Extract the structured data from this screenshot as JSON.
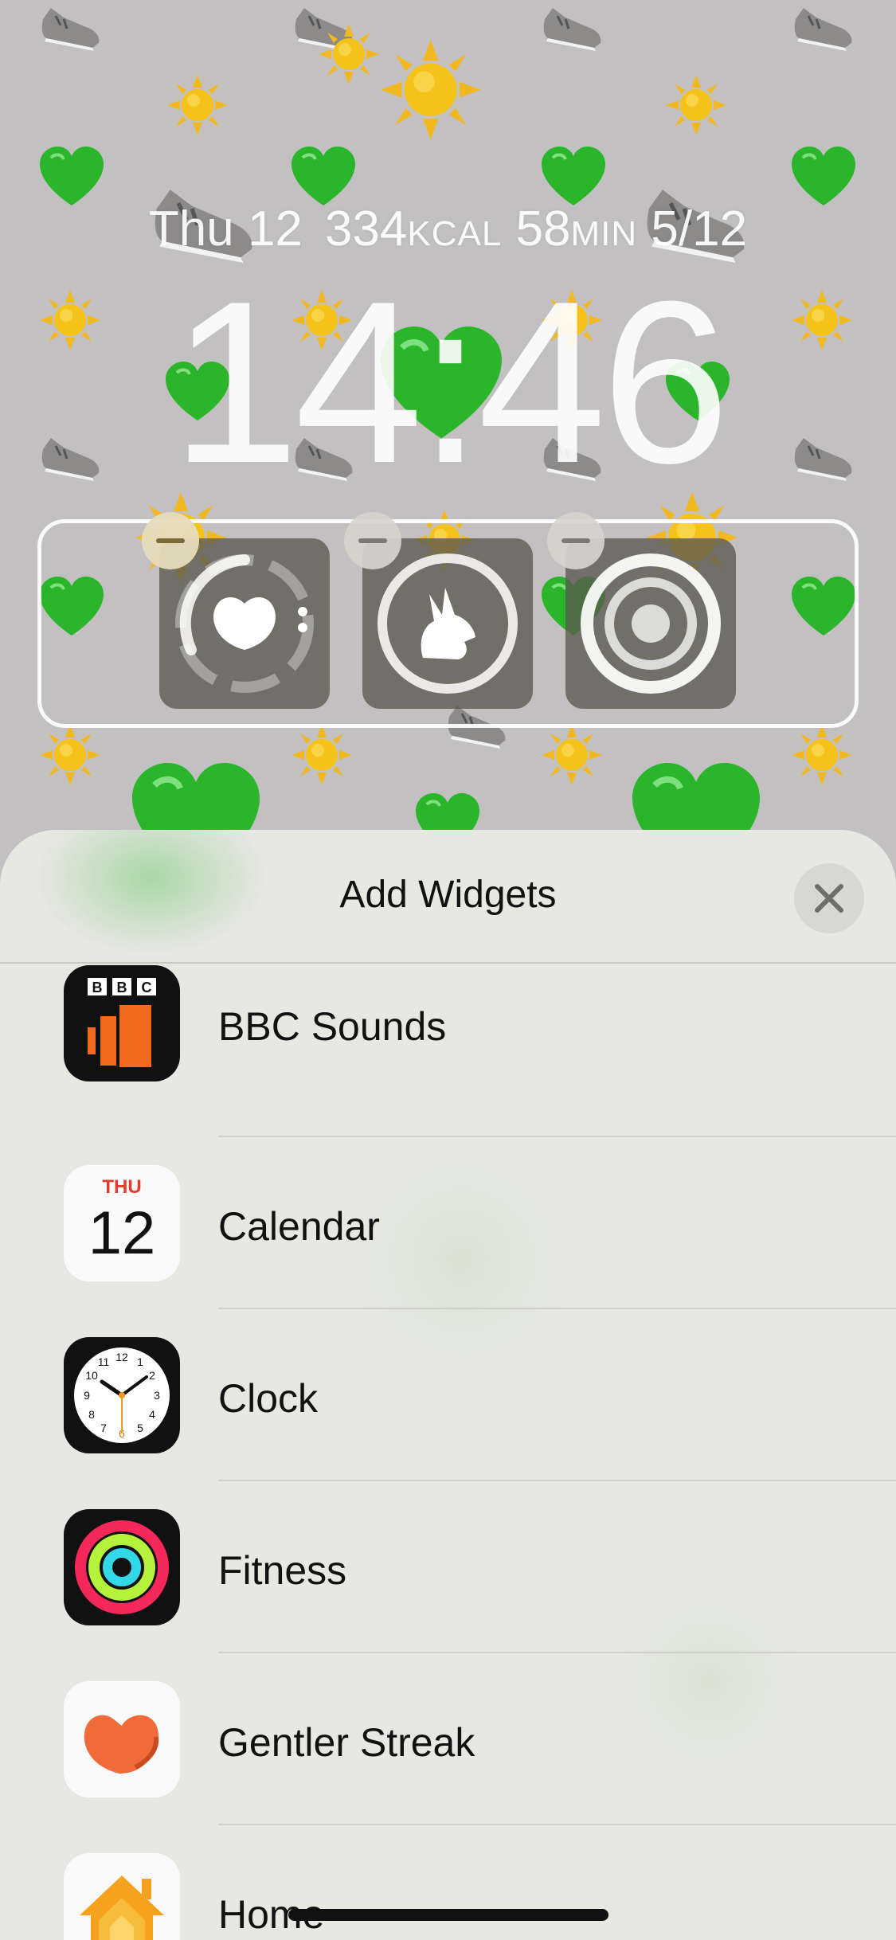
{
  "lock_screen": {
    "date": "Thu 12",
    "calories_value": "334",
    "calories_unit": "KCAL",
    "minutes_value": "58",
    "minutes_unit": "MIN",
    "steps_progress": "5/12",
    "time": "14:46",
    "widgets": [
      {
        "name": "gentler-streak-widget",
        "icon": "heart-blob-icon"
      },
      {
        "name": "rabbit-widget",
        "icon": "rabbit-icon"
      },
      {
        "name": "rings-widget",
        "icon": "concentric-rings-icon"
      }
    ]
  },
  "sheet": {
    "title": "Add Widgets",
    "close_icon": "close-icon",
    "apps": [
      {
        "label": "BBC Sounds",
        "icon": "bbc-sounds-icon",
        "icon_text": "BBC"
      },
      {
        "label": "Calendar",
        "icon": "calendar-icon",
        "day_name": "THU",
        "day_number": "12"
      },
      {
        "label": "Clock",
        "icon": "clock-icon"
      },
      {
        "label": "Fitness",
        "icon": "fitness-rings-icon"
      },
      {
        "label": "Gentler Streak",
        "icon": "gentler-streak-icon"
      },
      {
        "label": "Home",
        "icon": "home-icon"
      }
    ]
  },
  "colors": {
    "sheet_background": "#e8e8e3",
    "bbc_orange": "#f06a1d",
    "calendar_red": "#e33b2e",
    "fitness_red": "#f5285a",
    "fitness_green": "#b6f13c",
    "fitness_cyan": "#32d7e8",
    "gentler_orange": "#f06a3a",
    "home_orange": "#f6a21e"
  }
}
